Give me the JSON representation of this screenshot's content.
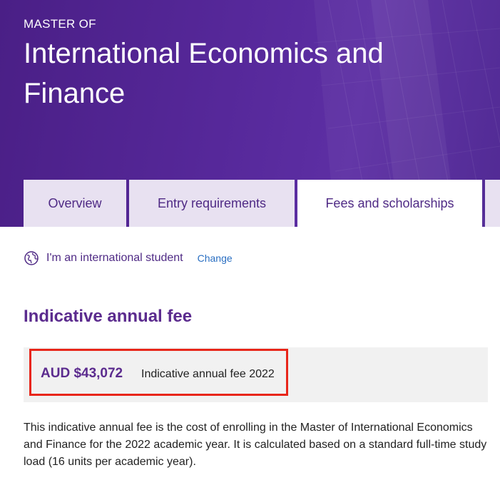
{
  "hero": {
    "eyebrow": "MASTER OF",
    "title": "International Economics and Finance"
  },
  "tabs": [
    {
      "label": "Overview",
      "active": false
    },
    {
      "label": "Entry requirements",
      "active": false
    },
    {
      "label": "Fees and scholarships",
      "active": true
    }
  ],
  "student_type": {
    "icon": "globe-icon",
    "text": "I'm an international student",
    "change_label": "Change"
  },
  "fees": {
    "section_title": "Indicative annual fee",
    "amount": "AUD $43,072",
    "label": "Indicative annual fee 2022",
    "description": "This indicative annual fee is the cost of enrolling in the Master of International Economics and Finance for the 2022 academic year. It is calculated based on a standard full-time study load (16 units per academic year)."
  },
  "colors": {
    "brand_purple": "#5b2b8e",
    "tab_inactive": "#e8e1f1",
    "highlight_border": "#e8261a",
    "link_blue": "#2a6fc2"
  }
}
